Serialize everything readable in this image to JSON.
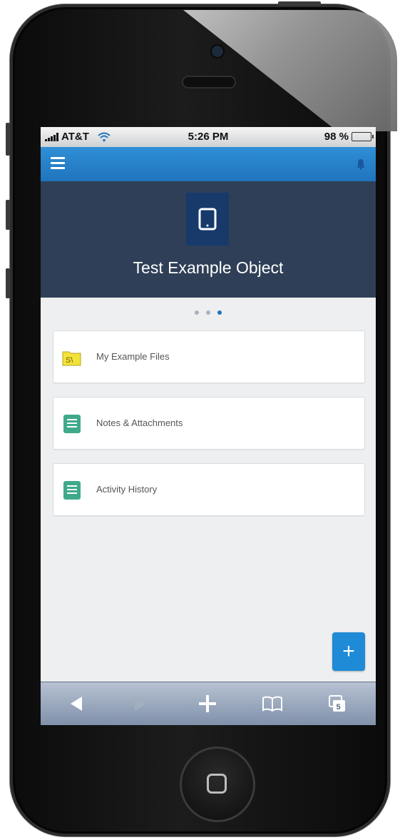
{
  "status_bar": {
    "carrier": "AT&T",
    "time": "5:26 PM",
    "battery": "98 %",
    "battery_level": 0.98
  },
  "header": {
    "menu_icon": "hamburger-icon",
    "notification_icon": "bell-icon"
  },
  "hero": {
    "icon": "tablet-icon",
    "title": "Test Example Object"
  },
  "pager": {
    "count": 3,
    "active_index": 2
  },
  "list": [
    {
      "label": "My Example Files",
      "icon": "folder-files-icon",
      "color": "#f2e23a"
    },
    {
      "label": "Notes & Attachments",
      "icon": "notes-icon",
      "color": "#3fa98b"
    },
    {
      "label": "Activity History",
      "icon": "activity-icon",
      "color": "#3fa98b"
    }
  ],
  "fab": {
    "label": "+",
    "icon": "plus-icon"
  },
  "browser_toolbar": {
    "items": [
      "back-icon",
      "forward-icon",
      "add-icon",
      "bookmarks-icon",
      "tabs-icon"
    ],
    "tabs_count": "5"
  },
  "colors": {
    "header_blue": "#1f74bd",
    "hero_bg": "#2f3f57",
    "accent": "#1f8ad6"
  }
}
